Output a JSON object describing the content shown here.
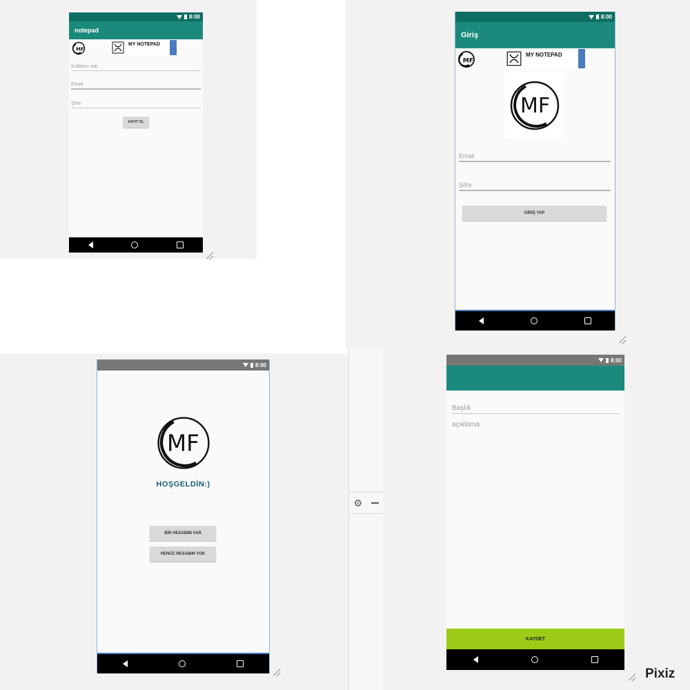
{
  "watermark": "Pixiz",
  "status_time": "8:00",
  "colors": {
    "primary": "#1b8a7c",
    "primary_dark": "#0f6e62",
    "gray_status": "#777777",
    "save_green": "#9ccb19",
    "button_gray": "#d9d9d9"
  },
  "icons": [
    "wifi-icon",
    "battery-icon",
    "back-icon",
    "home-icon",
    "recents-icon",
    "gear-icon",
    "minus-icon",
    "resize-handle-icon"
  ],
  "register_screen": {
    "appbar_title": "notepad",
    "banner_title": "MY NOTEPAD",
    "fields": [
      {
        "placeholder": "Kullanıcı adı"
      },
      {
        "placeholder": "Email"
      },
      {
        "placeholder": "Şifre"
      }
    ],
    "button": "KAYIT OL"
  },
  "login_screen": {
    "appbar_title": "Giriş",
    "banner_title": "MY NOTEPAD",
    "logo_text": "MF",
    "fields": [
      {
        "placeholder": "Email"
      },
      {
        "placeholder": "Şifre"
      }
    ],
    "button": "GİRİŞ YAP"
  },
  "welcome_screen": {
    "logo_text": "MF",
    "greeting": "HOŞGELDİN:)",
    "buttons": [
      "BİR HESABIM VAR",
      "HENÜZ HESABIM YOK"
    ]
  },
  "note_screen": {
    "fields": [
      {
        "placeholder": "Başlık"
      },
      {
        "placeholder": "açıklama"
      }
    ],
    "save_button": "KAYDET"
  }
}
